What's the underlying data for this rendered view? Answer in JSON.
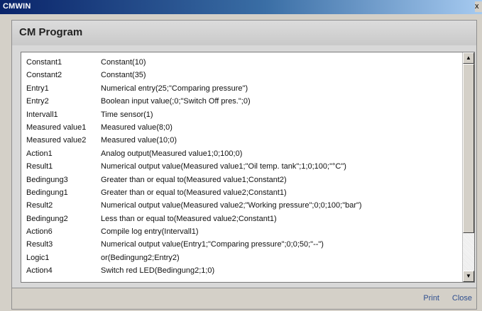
{
  "window": {
    "title": "CMWIN",
    "close_glyph": "x"
  },
  "header": {
    "title": "CM Program"
  },
  "program": {
    "rows": [
      {
        "name": "Constant1",
        "expr": "Constant(10)"
      },
      {
        "name": "Constant2",
        "expr": "Constant(35)"
      },
      {
        "name": "Entry1",
        "expr": "Numerical entry(25;\"Comparing pressure\")"
      },
      {
        "name": "Entry2",
        "expr": "Boolean input value(;0;\"Switch Off pres.\";0)"
      },
      {
        "name": "Intervall1",
        "expr": "Time sensor(1)"
      },
      {
        "name": "Measured value1",
        "expr": "Measured value(8;0)"
      },
      {
        "name": "Measured value2",
        "expr": "Measured value(10;0)"
      },
      {
        "name": "Action1",
        "expr": "Analog output(Measured value1;0;100;0)"
      },
      {
        "name": "Result1",
        "expr": "Numerical output value(Measured value1;\"Oil temp. tank\";1;0;100;\"°C\")"
      },
      {
        "name": "Bedingung3",
        "expr": "Greater than or equal to(Measured value1;Constant2)"
      },
      {
        "name": "Bedingung1",
        "expr": "Greater than or equal to(Measured value2;Constant1)"
      },
      {
        "name": "Result2",
        "expr": "Numerical output value(Measured value2;\"Working pressure\";0;0;100;\"bar\")"
      },
      {
        "name": "Bedingung2",
        "expr": "Less than or equal to(Measured value2;Constant1)"
      },
      {
        "name": "Action6",
        "expr": "Compile log entry(Intervall1)"
      },
      {
        "name": "Result3",
        "expr": "Numerical output value(Entry1;\"Comparing pressure\";0;0;50;\"--\")"
      },
      {
        "name": "Logic1",
        "expr": "or(Bedingung2;Entry2)"
      },
      {
        "name": "Action4",
        "expr": "Switch red LED(Bedingung2;1;0)"
      }
    ]
  },
  "scrollbar": {
    "up_glyph": "▲",
    "down_glyph": "▼",
    "thumb_fraction": 0.82
  },
  "footer": {
    "print_label": "Print",
    "close_label": "Close"
  }
}
